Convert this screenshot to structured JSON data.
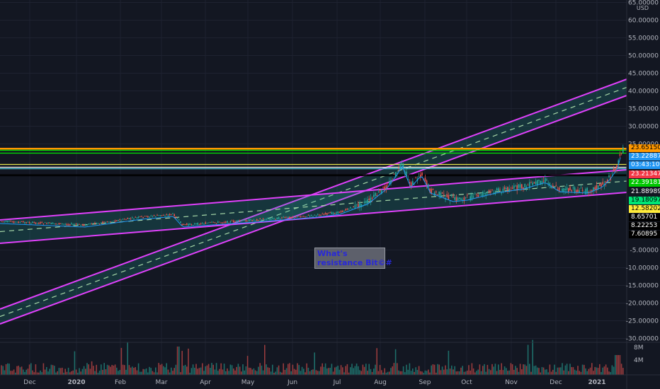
{
  "currency": "USD",
  "y_axis_labels": [
    {
      "value": 65,
      "text": "65.00000"
    },
    {
      "value": 60,
      "text": "60.00000"
    },
    {
      "value": 55,
      "text": "55.00000"
    },
    {
      "value": 50,
      "text": "50.00000"
    },
    {
      "value": 45,
      "text": "45.00000"
    },
    {
      "value": 40,
      "text": "40.00000"
    },
    {
      "value": 35,
      "text": "35.00000"
    },
    {
      "value": 30,
      "text": "30.00000"
    },
    {
      "value": 25,
      "text": "25.00000"
    },
    {
      "value": -5,
      "text": "-5.00000"
    },
    {
      "value": -10,
      "text": "-10.00000"
    },
    {
      "value": -15,
      "text": "-15.00000"
    },
    {
      "value": -20,
      "text": "-20.00000"
    },
    {
      "value": -25,
      "text": "-25.00000"
    },
    {
      "value": -30,
      "text": "-30.00000"
    }
  ],
  "x_axis_labels": [
    {
      "text": "Dec",
      "bold": false
    },
    {
      "text": "2020",
      "bold": true
    },
    {
      "text": "Feb",
      "bold": false
    },
    {
      "text": "Mar",
      "bold": false
    },
    {
      "text": "Apr",
      "bold": false
    },
    {
      "text": "May",
      "bold": false
    },
    {
      "text": "Jun",
      "bold": false
    },
    {
      "text": "Jul",
      "bold": false
    },
    {
      "text": "Aug",
      "bold": false
    },
    {
      "text": "Sep",
      "bold": false
    },
    {
      "text": "Oct",
      "bold": false
    },
    {
      "text": "Nov",
      "bold": false
    },
    {
      "text": "Dec",
      "bold": false
    },
    {
      "text": "2021",
      "bold": true
    }
  ],
  "volume_axis_labels": [
    "8M",
    "4M"
  ],
  "price_tags": [
    {
      "text": "23.65150",
      "bg": "#ff9800",
      "fg": "#000000"
    },
    {
      "text": "23.22887",
      "bg": "#2196f3",
      "fg": "#ffffff"
    },
    {
      "text": "03:43:10",
      "bg": "#2196f3",
      "fg": "#ffffff"
    },
    {
      "text": "23.21347",
      "bg": "#f23645",
      "fg": "#ffffff"
    },
    {
      "text": "22.39181",
      "bg": "#00c800",
      "fg": "#ffffff"
    },
    {
      "text": "21.88989",
      "bg": "#131722",
      "fg": "#ffffff"
    },
    {
      "text": "19.18097",
      "bg": "#00e676",
      "fg": "#000000"
    },
    {
      "text": "12.58202",
      "bg": "#ffeb3b",
      "fg": "#000000"
    },
    {
      "text": "8.65701",
      "bg": "#000000",
      "fg": "#ffffff"
    },
    {
      "text": "8.22253",
      "bg": "#000000",
      "fg": "#ffffff"
    },
    {
      "text": "7.60895",
      "bg": "#000000",
      "fg": "#ffffff"
    }
  ],
  "horizontal_levels": [
    {
      "value": 23.65,
      "color": "#ff9800"
    },
    {
      "value": 23.2,
      "color": "#00e600"
    },
    {
      "value": 22.4,
      "color": "#00e600"
    },
    {
      "value": 19.2,
      "color": "#e6e64d"
    },
    {
      "value": 18.4,
      "color": "#ffffff"
    },
    {
      "value": 18.0,
      "color": "#4dd0e1"
    },
    {
      "value": 16.3,
      "color": "#000000"
    },
    {
      "value": 16.0,
      "color": "#000000"
    }
  ],
  "annotation": {
    "line1": "What's",
    "line2": "resistance Bit©#"
  },
  "colors": {
    "background": "#131722",
    "channel_border": "#e040fb",
    "channel_fill": "#26a69a",
    "up_candle": "#26a69a",
    "down_candle": "#ef5350"
  }
}
